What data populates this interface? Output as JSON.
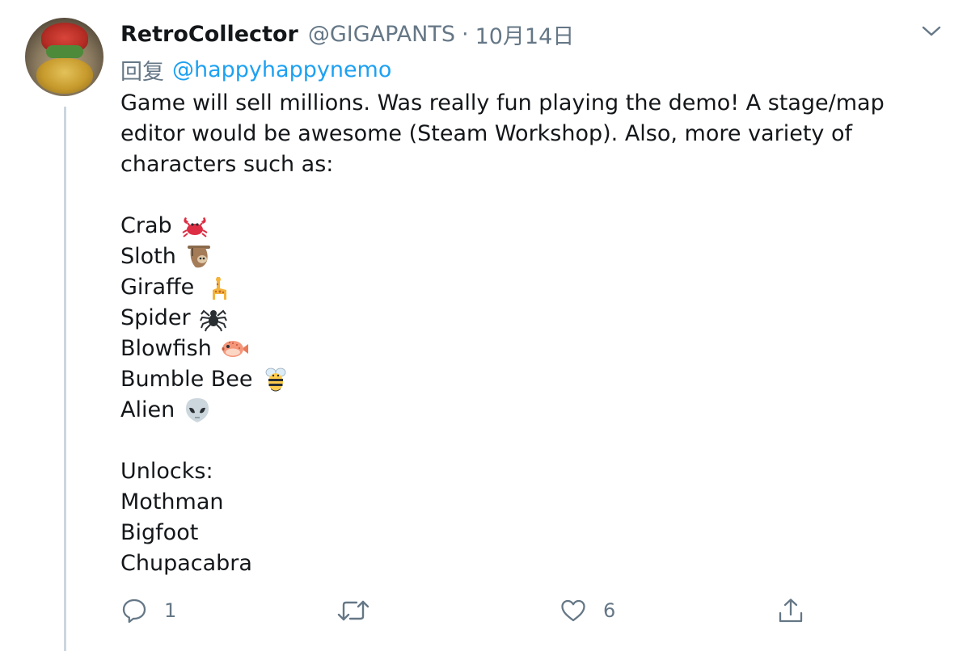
{
  "tweet": {
    "author_name": "RetroCollector",
    "handle": "@GIGAPANTS",
    "separator": "·",
    "date": "10月14日",
    "reply_prefix": "回复",
    "reply_mention": "@happyhappynemo",
    "body_intro": "Game will sell millions. Was really fun playing the demo! A stage/map editor would be awesome (Steam Workshop). Also, more variety of characters such as:",
    "characters": [
      {
        "label": "Crab",
        "icon": "crab-emoji-icon"
      },
      {
        "label": "Sloth",
        "icon": "sloth-emoji-icon"
      },
      {
        "label": "Giraffe",
        "icon": "giraffe-emoji-icon"
      },
      {
        "label": "Spider",
        "icon": "spider-emoji-icon"
      },
      {
        "label": "Blowfish",
        "icon": "blowfish-emoji-icon"
      },
      {
        "label": "Bumble Bee",
        "icon": "bee-emoji-icon"
      },
      {
        "label": "Alien",
        "icon": "alien-emoji-icon"
      }
    ],
    "unlocks_heading": "Unlocks:",
    "unlocks": [
      "Mothman",
      "Bigfoot",
      "Chupacabra"
    ]
  },
  "actions": {
    "reply_count": "1",
    "retweet_count": "",
    "like_count": "6",
    "share_count": ""
  },
  "colors": {
    "text_primary": "#14171a",
    "text_secondary": "#657786",
    "link": "#1da1f2",
    "thread_line": "#ccd6dd"
  },
  "icons": [
    "chevron-down-icon",
    "reply-icon",
    "retweet-icon",
    "like-icon",
    "share-icon"
  ]
}
